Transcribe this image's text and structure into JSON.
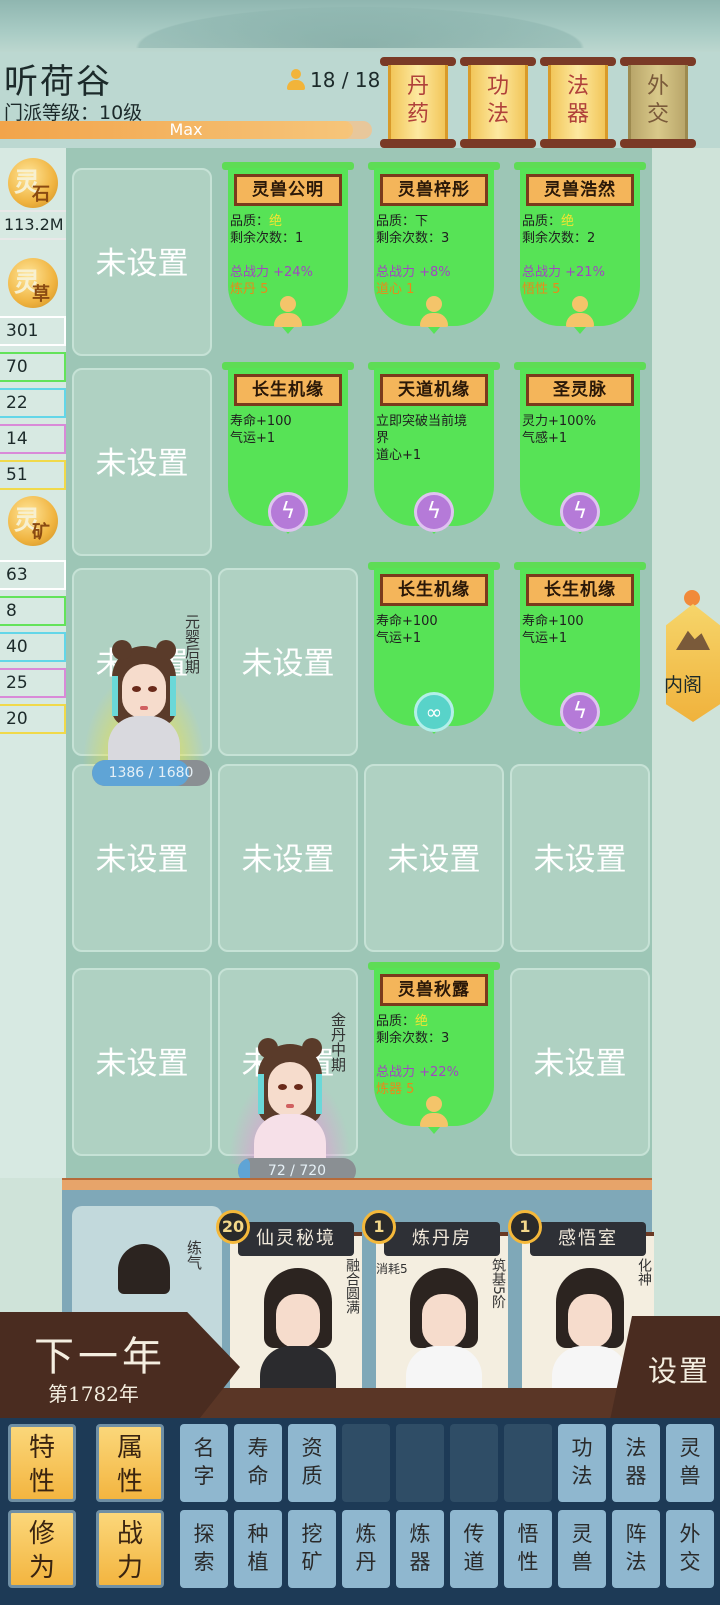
{
  "header": {
    "sect_name": "听荷谷",
    "sect_level_label": "门派等级：10级",
    "level_bar_text": "Max",
    "level_fill": 0.95,
    "disciple_count": "18 / 18",
    "scroll_buttons": [
      {
        "label": "丹\n药",
        "dim": false
      },
      {
        "label": "功\n法",
        "dim": false
      },
      {
        "label": "法\n器",
        "dim": false
      },
      {
        "label": "外\n交",
        "dim": true
      }
    ]
  },
  "resources": {
    "coins": [
      {
        "big": "灵",
        "small": "石"
      },
      {
        "big": "灵",
        "small": "草"
      },
      {
        "big": "灵",
        "small": "矿"
      }
    ],
    "stone_total": "113.2M",
    "herbs": [
      "301",
      "70",
      "22",
      "14",
      "51"
    ],
    "ores": [
      "63",
      "8",
      "40",
      "25",
      "20"
    ],
    "tier_colors": [
      "#ffffff",
      "#63e35a",
      "#63d6e8",
      "#d98ad8",
      "#f0d94a"
    ]
  },
  "grid": {
    "unset_label": "未设置",
    "cards": {
      "r1c2": {
        "title": "灵兽公明",
        "lines": [
          "品质：",
          "剩余次数：1",
          "",
          "总战力 +24%",
          "炼丹 5"
        ],
        "quality": "绝",
        "pic": "person"
      },
      "r1c3": {
        "title": "灵兽梓彤",
        "lines": [
          "品质：下",
          "剩余次数：3",
          "",
          "总战力 +8%",
          "道心 1"
        ],
        "quality": "",
        "pic": "person"
      },
      "r1c4": {
        "title": "灵兽浩然",
        "lines": [
          "品质：",
          "剩余次数：2",
          "",
          "总战力 +21%",
          "悟性 5"
        ],
        "quality": "绝",
        "pic": "person"
      },
      "r2c2": {
        "title": "长生机缘",
        "lines": [
          "寿命+100",
          "气运+1"
        ],
        "pic": "bolt"
      },
      "r2c3": {
        "title": "天道机缘",
        "lines": [
          "立即突破当前境",
          "界",
          "道心+1"
        ],
        "pic": "bolt"
      },
      "r2c4": {
        "title": "圣灵脉",
        "lines": [
          "灵力+100%",
          "气感+1"
        ],
        "pic": "bolt"
      },
      "r3c3": {
        "title": "长生机缘",
        "lines": [
          "寿命+100",
          "气运+1"
        ],
        "pic": "swirl"
      },
      "r3c4": {
        "title": "长生机缘",
        "lines": [
          "寿命+100",
          "气运+1"
        ],
        "pic": "bolt"
      },
      "r5c3": {
        "title": "灵兽秋露",
        "lines": [
          "品质：",
          "剩余次数：3",
          "",
          "总战力 +22%",
          "炼器 5"
        ],
        "quality": "绝",
        "pic": "person"
      }
    },
    "pic_glyphs": {
      "bolt": "ϟ",
      "swirl": "∞"
    },
    "characters": [
      {
        "realm": "元婴后期",
        "hp": "1386 / 1680",
        "hp_frac": 0.825,
        "glow": "#f4e431"
      },
      {
        "realm": "金丹中期",
        "hp": "72 / 720",
        "hp_frac": 0.1,
        "glow": "#f08ad8"
      }
    ]
  },
  "side_tab": {
    "label": "内阁"
  },
  "buildings": {
    "left_char_realm": "练气",
    "items": [
      {
        "badge": "20",
        "title": "仙灵秘境",
        "side": "融合圆满",
        "cost": ""
      },
      {
        "badge": "1",
        "title": "炼丹房",
        "side": "筑基5阶",
        "cost": "消耗5"
      },
      {
        "badge": "1",
        "title": "感悟室",
        "side": "化神",
        "cost": ""
      }
    ]
  },
  "bottom": {
    "next_year": "下一年",
    "year_label": "第1782年",
    "settings": "设置"
  },
  "sort_buttons": {
    "row1": [
      {
        "label": "特\n性",
        "style": "gold"
      },
      {
        "label": "属\n性",
        "style": "gold"
      },
      {
        "label": "名\n字",
        "style": "blue"
      },
      {
        "label": "寿\n命",
        "style": "blue"
      },
      {
        "label": "资\n质",
        "style": "blue"
      },
      {
        "label": "",
        "style": "empty"
      },
      {
        "label": "",
        "style": "empty"
      },
      {
        "label": "",
        "style": "empty"
      },
      {
        "label": "",
        "style": "empty"
      },
      {
        "label": "功\n法",
        "style": "blue"
      },
      {
        "label": "法\n器",
        "style": "blue"
      },
      {
        "label": "灵\n兽",
        "style": "blue"
      }
    ],
    "row2": [
      {
        "label": "修\n为",
        "style": "gold"
      },
      {
        "label": "战\n力",
        "style": "gold"
      },
      {
        "label": "探\n索",
        "style": "blue"
      },
      {
        "label": "种\n植",
        "style": "blue"
      },
      {
        "label": "挖\n矿",
        "style": "blue"
      },
      {
        "label": "炼\n丹",
        "style": "blue"
      },
      {
        "label": "炼\n器",
        "style": "blue"
      },
      {
        "label": "传\n道",
        "style": "blue"
      },
      {
        "label": "悟\n性",
        "style": "blue"
      },
      {
        "label": "灵\n兽",
        "style": "blue"
      },
      {
        "label": "阵\n法",
        "style": "blue"
      },
      {
        "label": "外\n交",
        "style": "blue"
      }
    ]
  }
}
